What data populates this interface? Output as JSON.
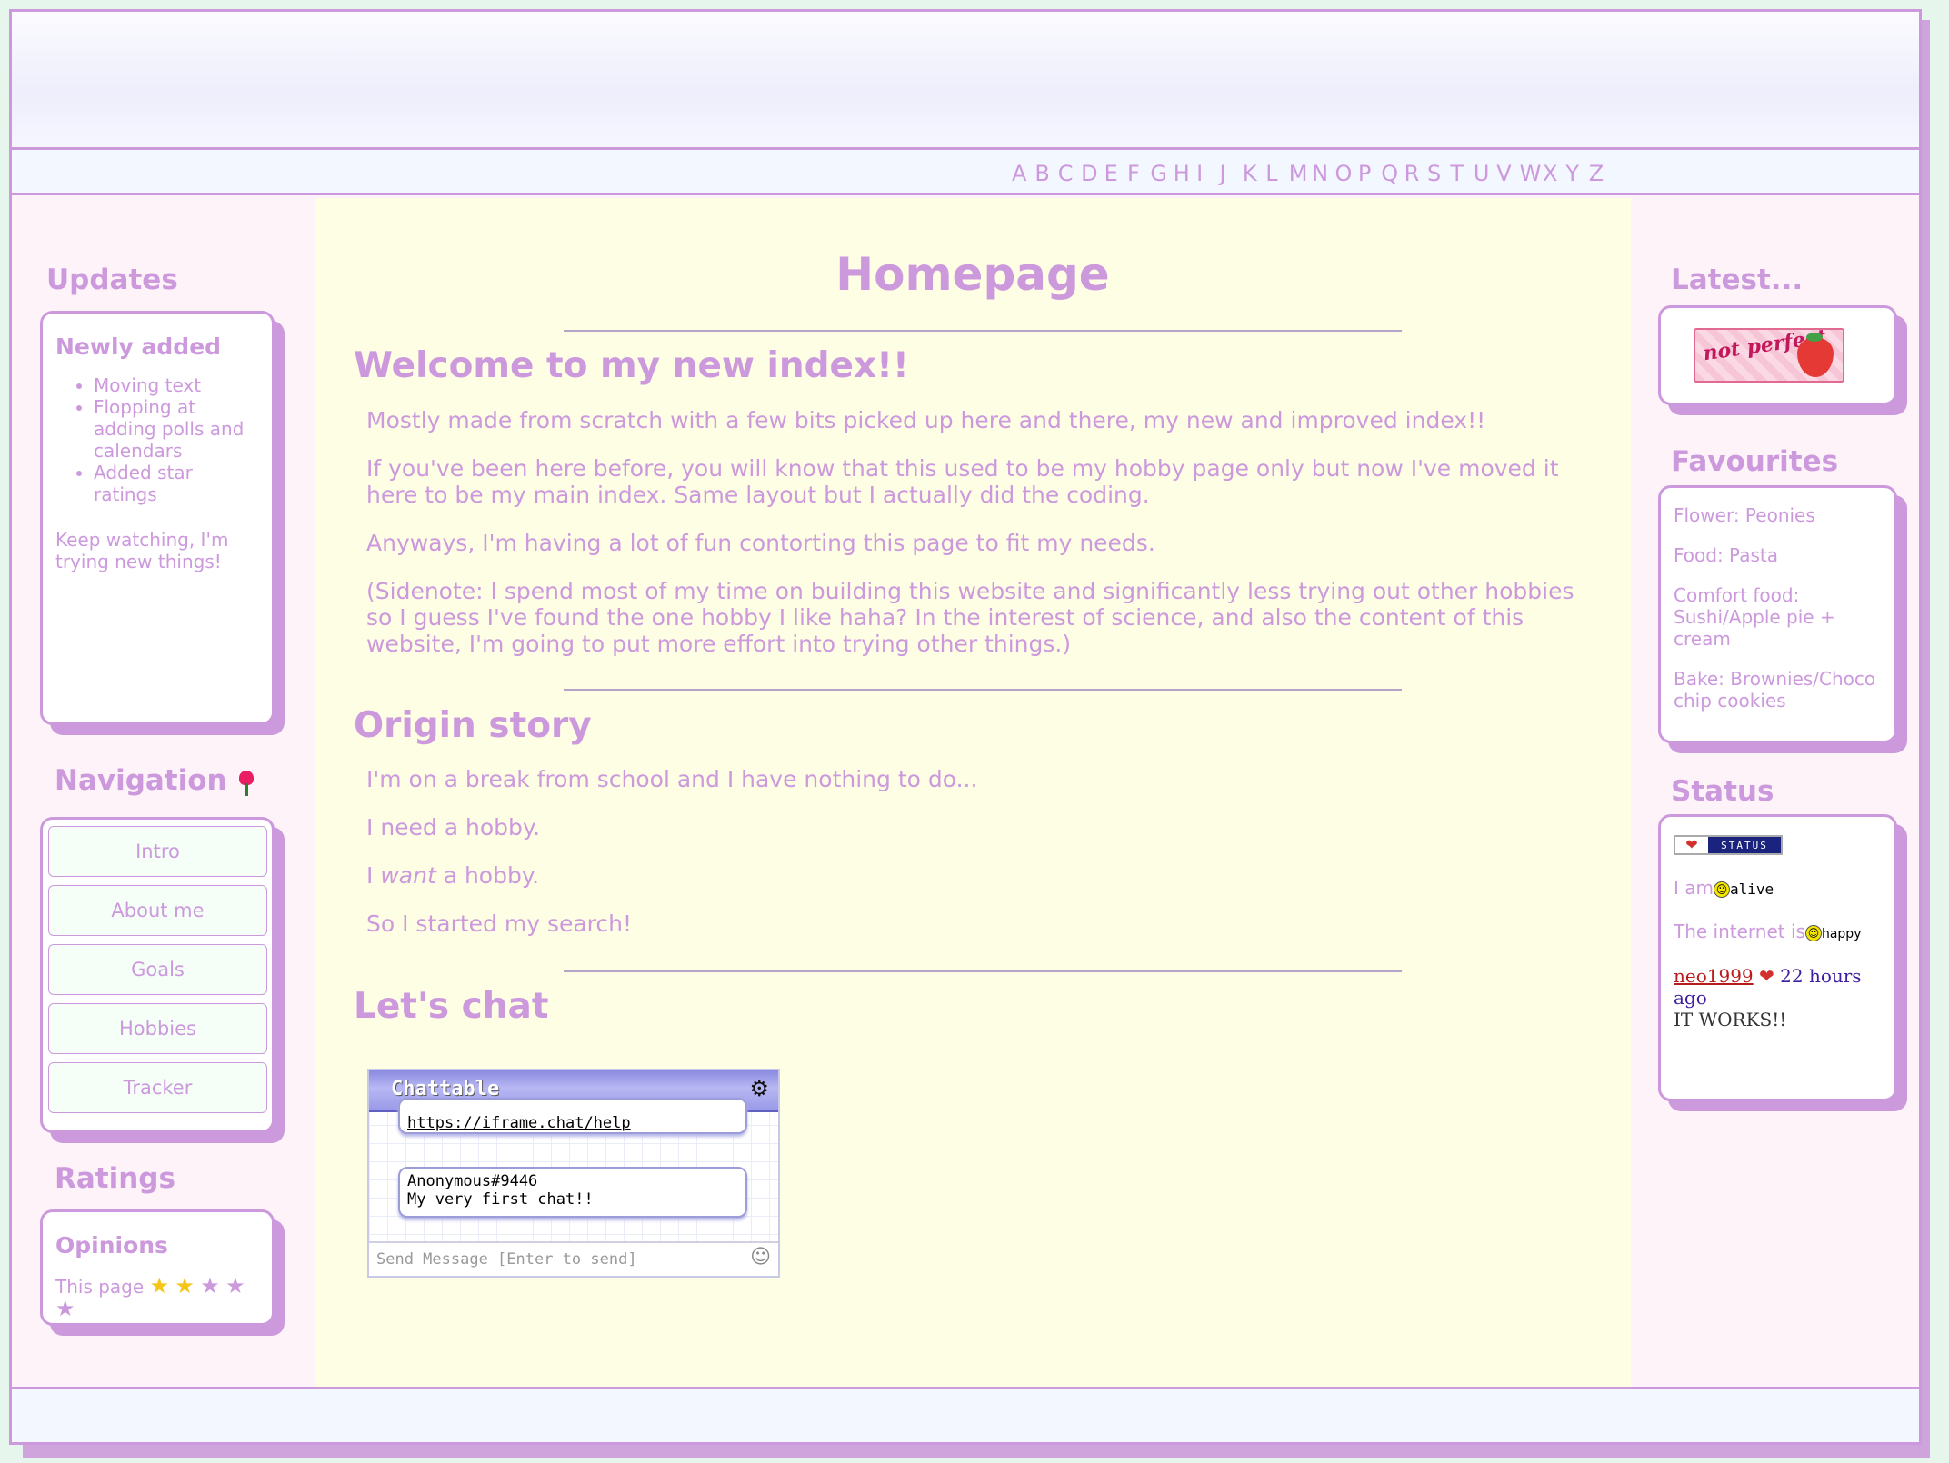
{
  "alphabet": [
    "A",
    "B",
    "C",
    "D",
    "E",
    "F",
    "G",
    "H",
    "I",
    "J",
    "K",
    "L",
    "M",
    "N",
    "O",
    "P",
    "Q",
    "R",
    "S",
    "T",
    "U",
    "V",
    "W",
    "X",
    "Y",
    "Z"
  ],
  "left": {
    "updates": {
      "title": "Updates",
      "subtitle": "Newly added",
      "items": [
        "Moving text",
        "Flopping at adding polls and calendars",
        "Added star ratings"
      ],
      "footer": "Keep watching, I'm trying new things!"
    },
    "navigation": {
      "title": "Navigation",
      "icon": "tulip-icon",
      "items": [
        "Intro",
        "About me",
        "Goals",
        "Hobbies",
        "Tracker"
      ]
    },
    "ratings": {
      "title": "Ratings",
      "subtitle": "Opinions",
      "label": "This page",
      "stars_filled": 2,
      "stars_total": 5,
      "star_color": "#f5c518",
      "star_empty_color": "#cc99dd"
    }
  },
  "main": {
    "title": "Homepage",
    "welcome_heading": "Welcome to my new index!!",
    "welcome_paragraphs": [
      "Mostly made from scratch with a few bits picked up here and there, my new and improved index!!",
      "If you've been here before, you will know that this used to be my hobby page only but now I've moved it here to be my main index. Same layout but I actually did the coding.",
      "Anyways, I'm having a lot of fun contorting this page to fit my needs.",
      "(Sidenote: I spend most of my time on building this website and significantly less trying out other hobbies so I guess I've found the one hobby I like haha? In the interest of science, and also the content of this website, I'm going to put more effort into trying other things.)"
    ],
    "origin_heading": "Origin story",
    "origin_p1": "I'm on a break from school and I have nothing to do...",
    "origin_p2": "I need a hobby.",
    "origin_p3_pre": "I ",
    "origin_p3_em": "want",
    "origin_p3_post": " a hobby.",
    "origin_p4": "So I started my search!",
    "chat_heading": "Let's chat"
  },
  "chat": {
    "title": "Chattable",
    "help_link": "https://iframe.chat/help",
    "message_user": "Anonymous#9446",
    "message_text": "My very first chat!!",
    "input_placeholder": "Send Message [Enter to send]"
  },
  "right": {
    "latest": {
      "title": "Latest...",
      "image_text": "not perfect"
    },
    "favourites": {
      "title": "Favourites",
      "items": [
        "Flower: Peonies",
        "Food: Pasta",
        "Comfort food: Sushi/Apple pie + cream",
        "Bake: Brownies/Choco chip cookies"
      ]
    },
    "status": {
      "title": "Status",
      "badge_text": "STATUS",
      "iam_label": "I am",
      "iam_value": "alive",
      "internet_label": "The internet is",
      "internet_value": "happy",
      "post_user": "neo1999",
      "post_time": "22 hours ago",
      "post_text": "IT WORKS!!"
    }
  },
  "colors": {
    "accent": "#cc99dd",
    "main_bg": "#fefee4",
    "side_bg": "#fdf3f8"
  }
}
